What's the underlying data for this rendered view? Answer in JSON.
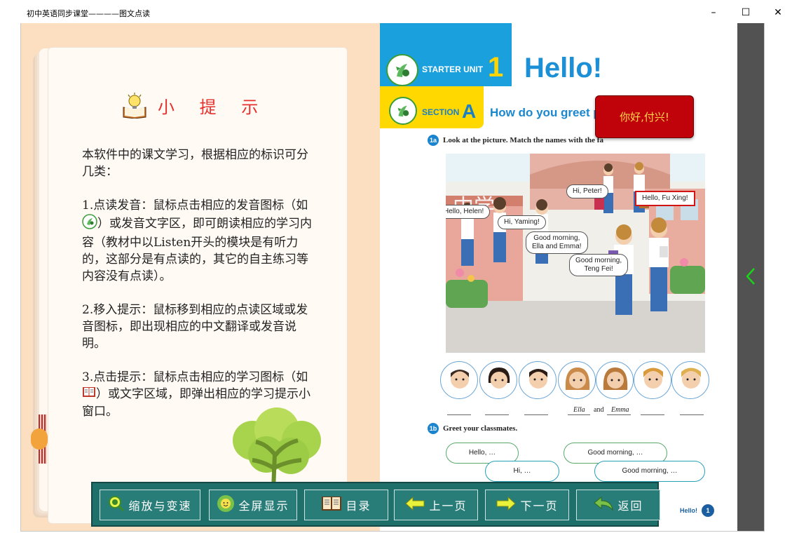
{
  "window": {
    "title": "初中英语同步课堂————图文点读",
    "minimize": "–",
    "maximize": "☐",
    "close": "✕"
  },
  "tips": {
    "title": "小 提 示",
    "intro": "本软件中的课文学习，根据相应的标识可分几类：",
    "item1_a": "1.点读发音：鼠标点击相应的发音图标（如",
    "item1_b": "）或发音文字区，即可朗读相应的学习内容（教材中以Listen开头的模块是有听力的，这部分是有点读的，其它的自主练习等内容没有点读）。",
    "item2": "2.移入提示：鼠标移到相应的点读区域或发音图标，即出现相应的中文翻译或发音说明。",
    "item3_a": "3.点击提示：鼠标点击相应的学习图标（如",
    "item3_b": "）或文字区域，即弹出相应的学习提示小窗口。"
  },
  "book": {
    "unit_label": "STARTER UNIT",
    "unit_number": "1",
    "unit_title": "Hello!",
    "section_label": "SECTION",
    "section_letter": "A",
    "section_title": "How do you greet people?",
    "step_1a_badge": "1a",
    "step_1a_text": "Look at the picture. Match the names with the fa",
    "step_1b_badge": "1b",
    "step_1b_text": "Greet your classmates.",
    "bubbles": {
      "hi_peter": "Hi, Peter!",
      "hello_fuxing": "Hello, Fu Xing!",
      "hello_helen": "Hello, Helen!",
      "hi_yaming": "Hi, Yaming!",
      "good_morning_ella_1": "Good morning,",
      "good_morning_ella_2": "Ella and Emma!",
      "good_morning_teng_1": "Good morning,",
      "good_morning_teng_2": "Teng Fei!"
    },
    "scene_sign": "中学",
    "answer_ella": "Ella",
    "answer_and": "and",
    "answer_emma": "Emma",
    "greet": {
      "hello": "Hello, …",
      "hi": "Hi, …",
      "good_morning_1": "Good morning, …",
      "good_morning_2": "Good morning, …"
    },
    "footer_title": "Hello!",
    "page_number": "1"
  },
  "tooltip": {
    "text": "你好,付兴!"
  },
  "toolbar": {
    "zoom": "缩放与变速",
    "fullscreen": "全屏显示",
    "toc": "目录",
    "prev": "上一页",
    "next": "下一页",
    "back": "返回"
  },
  "colors": {
    "page_bg": "#fbdfc0",
    "tips_title": "#e5302d",
    "unit_blue": "#1aa0dc",
    "section_yellow": "#ffd800",
    "toolbar": "#1f6f6b",
    "tooltip_bg": "#c0020a",
    "tooltip_text": "#ffd84a",
    "side_arrow": "#19d419"
  },
  "icons": {
    "audio": "speaker-sprout-icon",
    "book": "open-book-icon",
    "next_page": "chevron-left-icon"
  }
}
